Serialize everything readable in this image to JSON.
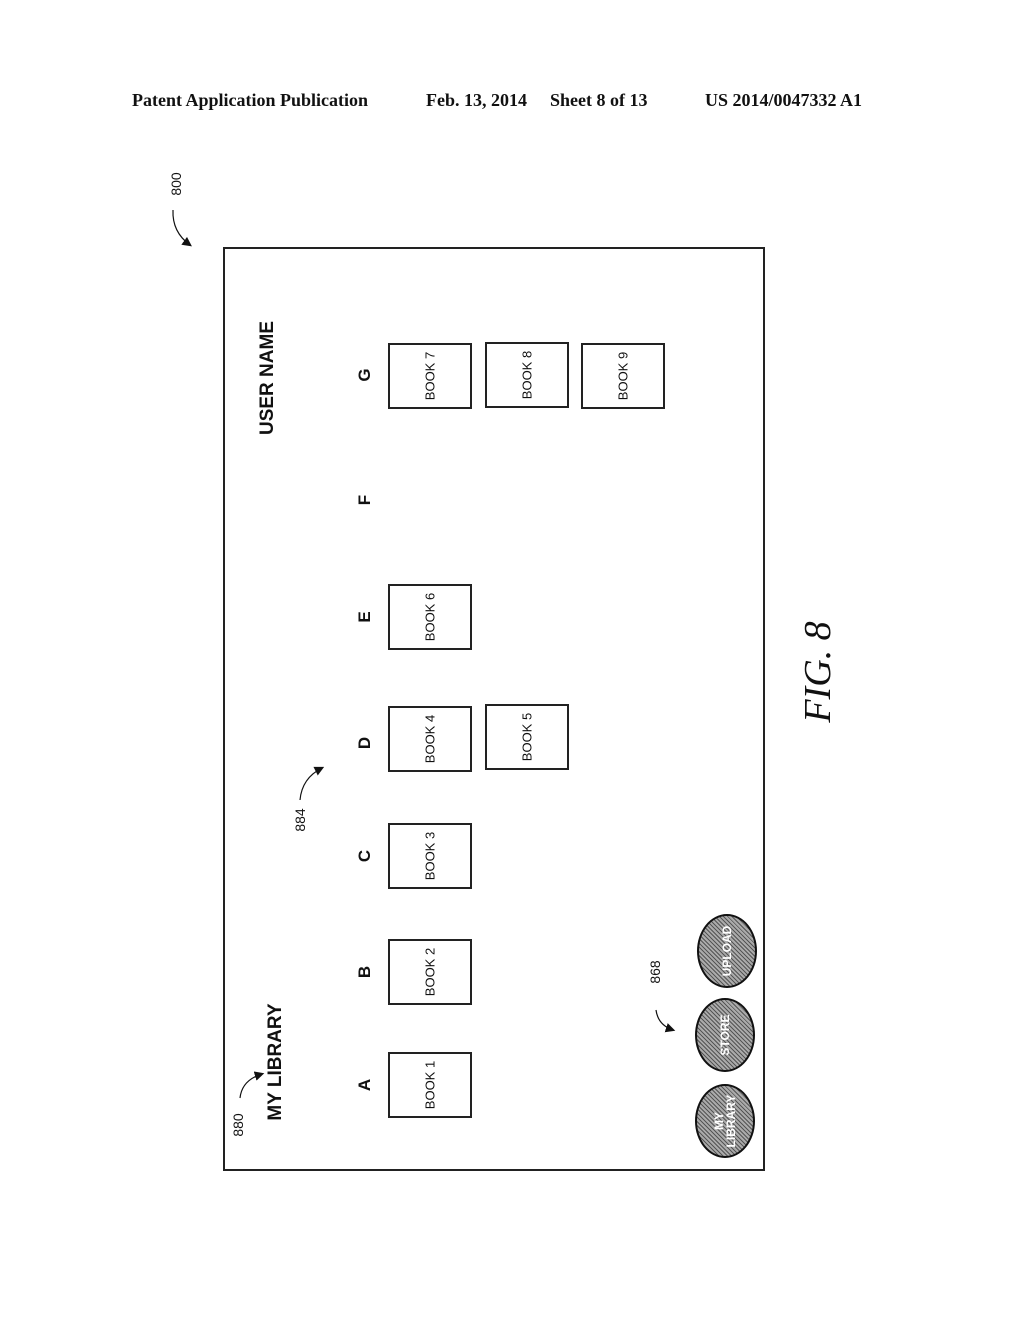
{
  "header": {
    "publication": "Patent Application Publication",
    "date": "Feb. 13, 2014",
    "sheet": "Sheet 8 of 13",
    "number": "US 2014/0047332 A1"
  },
  "refs": {
    "figure": "800",
    "title": "880",
    "shelf": "884",
    "nav": "868"
  },
  "screen": {
    "title": "MY LIBRARY",
    "user": "USER NAME",
    "columns": [
      "A",
      "B",
      "C",
      "D",
      "E",
      "F",
      "G"
    ],
    "books": [
      "BOOK 1",
      "BOOK 2",
      "BOOK 3",
      "BOOK 4",
      "BOOK 5",
      "BOOK 6",
      "BOOK 7",
      "BOOK 8",
      "BOOK 9"
    ],
    "nav": [
      "MY\nLIBRARY",
      "STORE",
      "UPLOAD"
    ]
  },
  "caption": "FIG. 8"
}
